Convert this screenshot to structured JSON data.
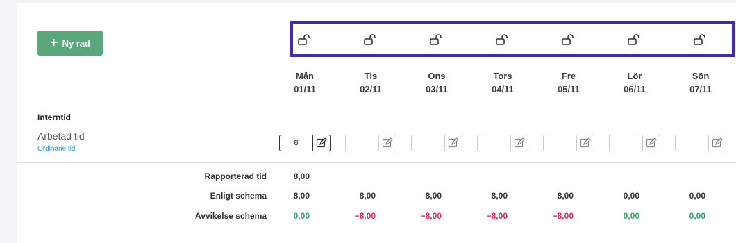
{
  "toolbar": {
    "new_row_label": "Ny rad"
  },
  "days": [
    {
      "name": "Mån",
      "date": "01/11",
      "input": "8",
      "reported": "8,00",
      "schedule": "8,00",
      "deviation": "0,00"
    },
    {
      "name": "Tis",
      "date": "02/11",
      "input": "",
      "reported": "",
      "schedule": "8,00",
      "deviation": "−8,00"
    },
    {
      "name": "Ons",
      "date": "03/11",
      "input": "",
      "reported": "",
      "schedule": "8,00",
      "deviation": "−8,00"
    },
    {
      "name": "Tors",
      "date": "04/11",
      "input": "",
      "reported": "",
      "schedule": "8,00",
      "deviation": "−8,00"
    },
    {
      "name": "Fre",
      "date": "05/11",
      "input": "",
      "reported": "",
      "schedule": "8,00",
      "deviation": "−8,00"
    },
    {
      "name": "Lör",
      "date": "06/11",
      "input": "",
      "reported": "",
      "schedule": "0,00",
      "deviation": "0,00"
    },
    {
      "name": "Sön",
      "date": "07/11",
      "input": "",
      "reported": "",
      "schedule": "0,00",
      "deviation": "0,00"
    }
  ],
  "section": {
    "title": "Interntid"
  },
  "row": {
    "title": "Arbetad tid",
    "subtitle": "Ordinarie tid"
  },
  "summary": {
    "reported_label": "Rapporterad tid",
    "schedule_label": "Enligt schema",
    "deviation_label": "Avvikelse schema"
  },
  "colors": {
    "accent": "#5aa77c",
    "highlight": "#3e2e9e",
    "negative": "#c7335a",
    "positive": "#3f9a6c",
    "link": "#3a93d6"
  },
  "icons": {
    "lock": "unlocked-padlock-icon",
    "edit": "edit-pencil-icon",
    "plus": "plus-icon"
  }
}
